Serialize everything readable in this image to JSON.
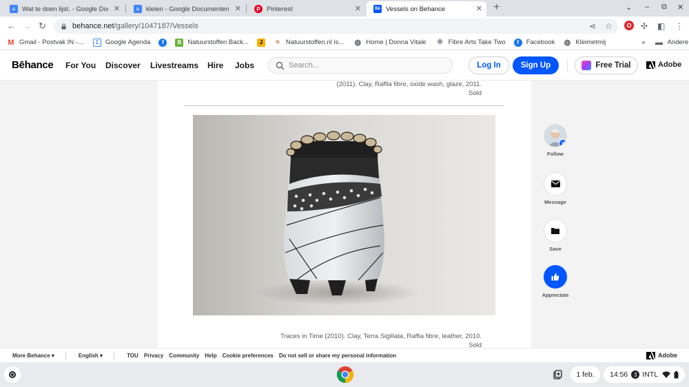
{
  "tabs": [
    {
      "title": "Wat te doen lijst. - Google Docum",
      "icon": "google-docs-icon",
      "color": "#4285f4"
    },
    {
      "title": "kleien - Google Documenten",
      "icon": "google-docs-icon",
      "color": "#4285f4"
    },
    {
      "title": "Pinterest",
      "icon": "pinterest-icon",
      "color": "#e60023"
    },
    {
      "title": "Vessels on Behance",
      "icon": "behance-icon",
      "color": "#0057ff",
      "active": true
    }
  ],
  "omnibox": {
    "host": "behance.net",
    "path": "/gallery/1047187/Vessels"
  },
  "bookmarks": [
    {
      "label": "Gmail - Postvak IN -...",
      "icon": "gmail-icon"
    },
    {
      "label": "Google Agenda",
      "icon": "calendar-icon"
    },
    {
      "label": "Natuurstoffen Back...",
      "icon": "b-icon"
    },
    {
      "label": "Natuurstoffen.nl is...",
      "icon": "natuurstoffen-icon"
    },
    {
      "label": "Home | Donna Vitale",
      "icon": "globe-icon"
    },
    {
      "label": "Fibre Arts Take Two",
      "icon": "sun-icon"
    },
    {
      "label": "Facebook",
      "icon": "facebook-icon"
    },
    {
      "label": "Kleimetmij",
      "icon": "globe-icon"
    }
  ],
  "other_bookmarks": "Andere bookmarks",
  "behance": {
    "logo": "Bēhance",
    "nav": [
      "For You",
      "Discover",
      "Livestreams",
      "Hire",
      "Jobs"
    ],
    "search_placeholder": "Search...",
    "login": "Log In",
    "signup": "Sign Up",
    "trial": "Free Trial",
    "adobe": "Adobe"
  },
  "gallery": {
    "caption_top_line1": "(2011). Clay, Raffia fibre, oxide wash, glaze, 2011.",
    "caption_top_line2": "Sold",
    "caption_bottom_line1": "Traces in Time (2010). Clay, Terra Sigillata, Raffia fibre, leather, 2010.",
    "caption_bottom_line2": "Sold"
  },
  "sidebar": {
    "follow": "Follow",
    "message": "Message",
    "save": "Save",
    "appreciate": "Appreciate"
  },
  "footer": {
    "more": "More Behance ▾",
    "lang": "English ▾",
    "links": [
      "TOU",
      "Privacy",
      "Community",
      "Help",
      "Cookie preferences",
      "Do not sell or share my personal information"
    ],
    "adobe": "Adobe"
  },
  "shelf": {
    "date": "1 feb.",
    "time": "14:56",
    "notif": "3",
    "ime": "INTL"
  }
}
